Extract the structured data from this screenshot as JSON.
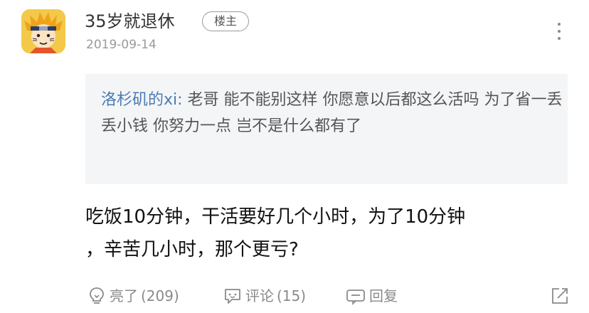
{
  "post": {
    "username": "35岁就退休",
    "op_badge": "楼主",
    "date": "2019-09-14",
    "quote": {
      "author": "洛杉矶的xi:",
      "text": " 老哥 能不能别这样 你愿意以后都这么活吗 为了省一丢丢小钱 你努力一点 岂不是什么都有了"
    },
    "content_line1": "吃饭10分钟，干活要好几个小时，为了10分钟",
    "content_line2": "，辛苦几小时，那个更亏?"
  },
  "actions": {
    "like_label": "亮了",
    "like_count": "(209)",
    "comment_label": "评论",
    "comment_count": "(15)",
    "reply_label": "回复"
  },
  "icons": {
    "like": "lightbulb-icon",
    "comment": "comment-icon",
    "reply": "reply-icon",
    "share": "share-icon",
    "more": "more-vertical-icon"
  },
  "colors": {
    "quote_author": "#4a7bb5",
    "quote_bg": "#f4f5f7",
    "muted": "#8a8a8a"
  }
}
